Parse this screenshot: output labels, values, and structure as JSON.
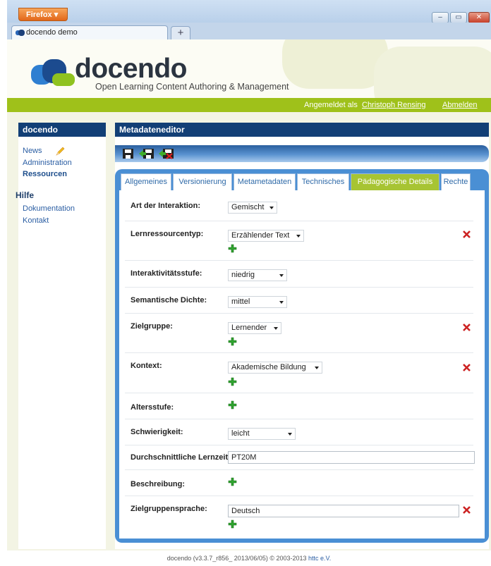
{
  "browser": {
    "menu_button": "Firefox",
    "tab_title": "docendo demo",
    "new_tab": "+",
    "window_controls": {
      "minimize": "–",
      "maximize": "▭",
      "close": "✕"
    }
  },
  "header": {
    "logo_text": "docendo",
    "subtitle": "Open Learning Content Authoring & Management",
    "logged_in_label": "Angemeldet als",
    "user_name": "Christoph Rensing",
    "logout": "Abmelden"
  },
  "sidebar": {
    "title": "docendo",
    "items": [
      {
        "label": "News",
        "icon": "pencil-icon"
      },
      {
        "label": "Administration"
      },
      {
        "label": "Ressourcen"
      }
    ],
    "help_title": "Hilfe",
    "help_items": [
      {
        "label": "Dokumentation"
      },
      {
        "label": "Kontakt"
      }
    ]
  },
  "panel": {
    "title": "Metadateneditor",
    "toolbar_icons": [
      "save-icon",
      "save-close-icon",
      "close-discard-icon"
    ],
    "tabs": [
      {
        "label": "Allgemeines",
        "active": false
      },
      {
        "label": "Versionierung",
        "active": false
      },
      {
        "label": "Metametadaten",
        "active": false
      },
      {
        "label": "Technisches",
        "active": false
      },
      {
        "label": "Pädagogische Details",
        "active": true
      },
      {
        "label": "Rechte",
        "active": false
      }
    ],
    "fields": {
      "interaction": {
        "label": "Art der Interaktion:",
        "value": "Gemischt"
      },
      "resource_type": {
        "label": "Lernressourcentyp:",
        "value": "Erzählender Text"
      },
      "interactivity": {
        "label": "Interaktivitätsstufe:",
        "value": "niedrig"
      },
      "semantic_density": {
        "label": "Semantische Dichte:",
        "value": "mittel"
      },
      "audience": {
        "label": "Zielgruppe:",
        "value": "Lernender"
      },
      "context": {
        "label": "Kontext:",
        "value": "Akademische Bildung"
      },
      "age": {
        "label": "Altersstufe:"
      },
      "difficulty": {
        "label": "Schwierigkeit:",
        "value": "leicht"
      },
      "learning_time": {
        "label": "Durchschnittliche Lernzeit:",
        "value": "PT20M"
      },
      "description": {
        "label": "Beschreibung:"
      },
      "language": {
        "label": "Zielgruppensprache:",
        "value": "Deutsch"
      }
    }
  },
  "footer": {
    "text": "docendo (v3.3.7_r856_ 2013/06/05) © 2003-2013",
    "link": "httc e.V."
  },
  "colors": {
    "header_green": "#9fc11a",
    "nav_blue": "#123f76",
    "active_tab": "#a7c433",
    "delete_red": "#cc2222",
    "add_green": "#2fa32f"
  }
}
